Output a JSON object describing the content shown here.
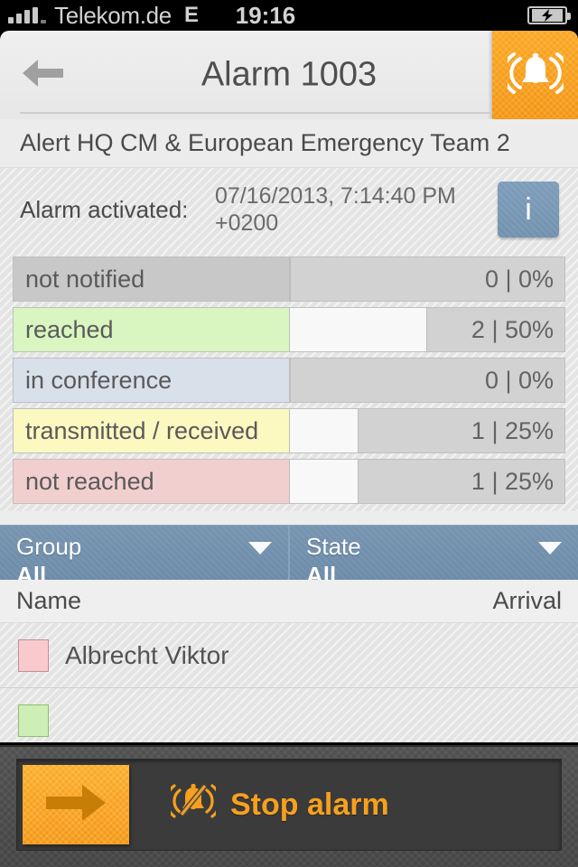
{
  "statusbar": {
    "carrier": "Telekom.de",
    "network": "E",
    "time": "19:16",
    "signal_icon": "signal-bars-icon",
    "battery_icon": "battery-charging-icon"
  },
  "header": {
    "back_icon": "back-arrow-icon",
    "title": "Alarm 1003",
    "alarm_icon": "alarm-bell-ringing-icon"
  },
  "subtitle": "Alert HQ CM & European Emergency Team 2",
  "activated": {
    "label": "Alarm activated:",
    "value": "07/16/2013, 7:14:40 PM +0200",
    "info_label": "i",
    "info_icon": "info-icon"
  },
  "stats": [
    {
      "label": "not notified",
      "count": "0",
      "percent": "0%",
      "value": "0 | 0%",
      "fill": 0,
      "color": "#c8c8c8"
    },
    {
      "label": "reached",
      "count": "2",
      "percent": "50%",
      "value": "2 | 50%",
      "fill": 50,
      "color": "#d9f5c0"
    },
    {
      "label": "in conference",
      "count": "0",
      "percent": "0%",
      "value": "0 | 0%",
      "fill": 0,
      "color": "#d8e0ea"
    },
    {
      "label": "transmitted / received",
      "count": "1",
      "percent": "25%",
      "value": "1 | 25%",
      "fill": 25,
      "color": "#fbf8c0"
    },
    {
      "label": "not reached",
      "count": "1",
      "percent": "25%",
      "value": "1 | 25%",
      "fill": 25,
      "color": "#f2cfcf"
    }
  ],
  "filters": [
    {
      "title": "Group",
      "value": "All",
      "caret_icon": "chevron-down-icon"
    },
    {
      "title": "State",
      "value": "All",
      "caret_icon": "chevron-down-icon"
    }
  ],
  "table": {
    "columns": {
      "name": "Name",
      "arrival": "Arrival"
    },
    "rows": [
      {
        "name": "Albrecht Viktor",
        "arrival": "",
        "status_color": "#f8cace"
      },
      {
        "name": "",
        "arrival": "",
        "status_color": "#cdeeb5"
      }
    ]
  },
  "bottom": {
    "handle_icon": "arrow-right-icon",
    "stop_icon": "bell-slash-icon",
    "stop_label": "Stop alarm"
  },
  "colors": {
    "accent_orange": "#f8a01c",
    "filter_blue": "#6f90ae",
    "info_blue": "#7292ae",
    "bottom_bar": "#4a4a4a"
  }
}
